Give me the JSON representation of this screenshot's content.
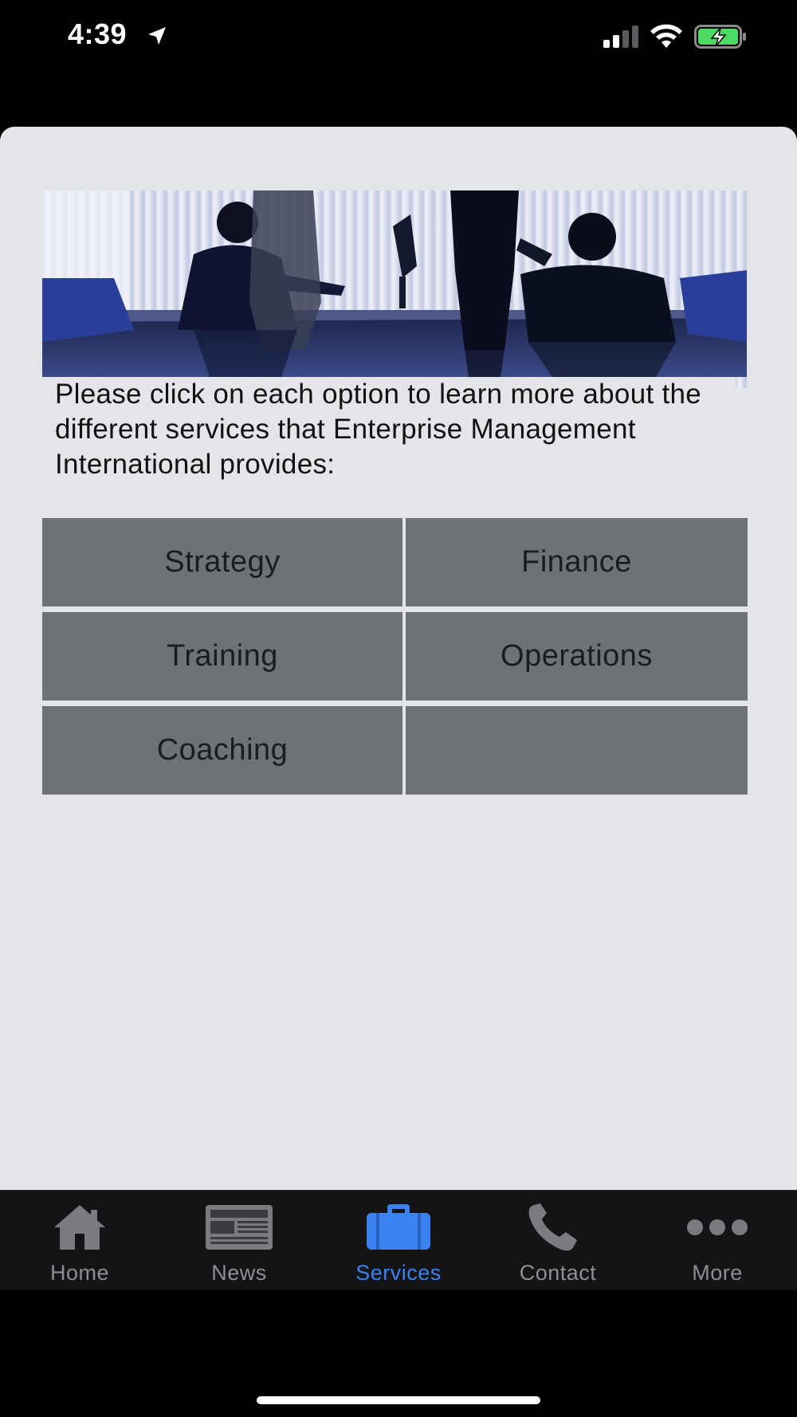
{
  "status_bar": {
    "time": "4:39",
    "icons": [
      "location-arrow-icon",
      "cellular-signal-icon",
      "wifi-icon",
      "battery-charging-icon"
    ],
    "battery_color": "#4cd964"
  },
  "banner": {
    "icon": "business-meeting-photo"
  },
  "intro": {
    "text": "Please click on each option to learn more about the different services that Enterprise Management International provides:"
  },
  "services": {
    "items": [
      {
        "label": "Strategy"
      },
      {
        "label": "Finance"
      },
      {
        "label": "Training"
      },
      {
        "label": "Operations"
      },
      {
        "label": "Coaching"
      },
      {
        "label": ""
      }
    ]
  },
  "tab_bar": {
    "active_color": "#3b82f0",
    "inactive_color": "#8e8e93",
    "tabs": [
      {
        "label": "Home",
        "icon": "home-icon"
      },
      {
        "label": "News",
        "icon": "newspaper-icon"
      },
      {
        "label": "Services",
        "icon": "briefcase-icon",
        "active": true
      },
      {
        "label": "Contact",
        "icon": "phone-icon"
      },
      {
        "label": "More",
        "icon": "more-dots-icon"
      }
    ]
  }
}
